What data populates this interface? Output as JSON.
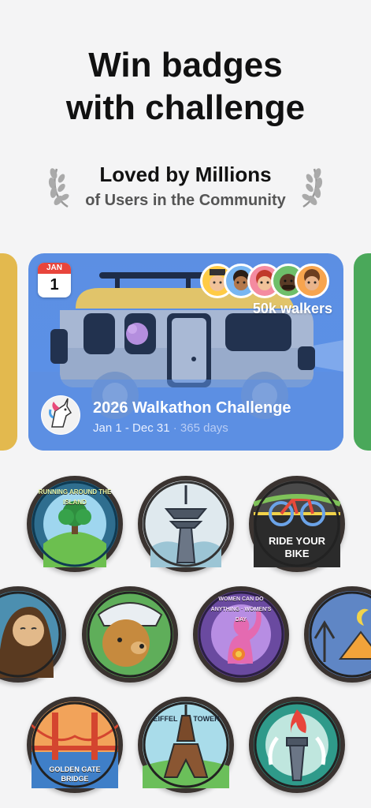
{
  "header": {
    "title_line1": "Win badges",
    "title_line2": "with challenge"
  },
  "social_proof": {
    "title": "Loved by Millions",
    "subtitle": "of Users in the Community"
  },
  "challenge": {
    "calendar_month": "JAN",
    "calendar_day": "1",
    "walkers": "50k walkers",
    "title": "2026 Walkathon Challenge",
    "dates": "Jan 1 - Dec 31",
    "separator": " · ",
    "duration": "365 days"
  },
  "badges": {
    "running_around_island": "RUNNING AROUND THE ISLAND",
    "ride_your_bike_line1": "RIDE YOUR",
    "ride_your_bike_line2": "BIKE",
    "womens_day": "WOMEN CAN DO ANYTHING · WOMEN'S DAY",
    "golden_gate_line1": "GOLDEN GATE",
    "golden_gate_line2": "BRIDGE",
    "eiffel_left": "EIFFEL",
    "eiffel_right": "TOWER"
  },
  "colors": {
    "card_blue": "#5b8fe4",
    "left_card": "#e3b94e",
    "right_card": "#4aa85a",
    "calendar_red": "#e8453c"
  }
}
